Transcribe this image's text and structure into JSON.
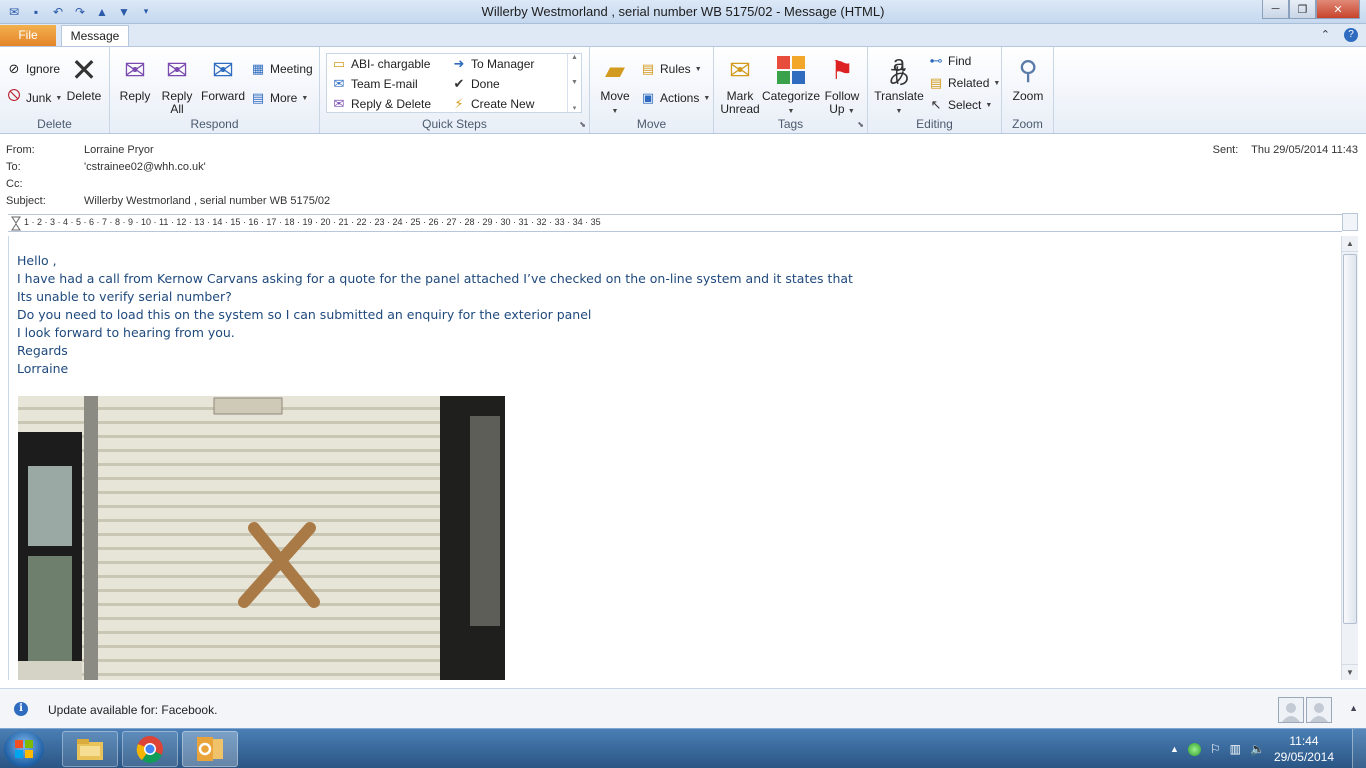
{
  "window": {
    "title": "Willerby Westmorland , serial number WB 5175/02  -  Message (HTML)",
    "minimize_icon": "minimize-icon",
    "maximize_icon": "restore-icon",
    "close_icon": "close-icon"
  },
  "tabs": {
    "file": "File",
    "message": "Message"
  },
  "ribbon": {
    "delete_group": {
      "label": "Delete",
      "ignore": "Ignore",
      "junk": "Junk",
      "delete": "Delete"
    },
    "respond_group": {
      "label": "Respond",
      "reply": "Reply",
      "reply_all_line1": "Reply",
      "reply_all_line2": "All",
      "forward": "Forward",
      "meeting": "Meeting",
      "more": "More"
    },
    "quick_steps_group": {
      "label": "Quick Steps",
      "items": [
        "ABI- chargable",
        "To Manager",
        "Team E-mail",
        "Done",
        "Reply & Delete",
        "Create New"
      ]
    },
    "move_group": {
      "label": "Move",
      "move": "Move",
      "rules": "Rules",
      "actions": "Actions"
    },
    "tags_group": {
      "label": "Tags",
      "mark_unread_line1": "Mark",
      "mark_unread_line2": "Unread",
      "categorize": "Categorize",
      "follow_up_line1": "Follow",
      "follow_up_line2": "Up"
    },
    "editing_group": {
      "label": "Editing",
      "translate": "Translate",
      "find": "Find",
      "related": "Related",
      "select": "Select"
    },
    "zoom_group": {
      "label": "Zoom",
      "zoom": "Zoom"
    }
  },
  "header": {
    "from_label": "From:",
    "from_value": "Lorraine Pryor",
    "to_label": "To:",
    "to_value": "'cstrainee02@whh.co.uk'",
    "cc_label": "Cc:",
    "cc_value": "",
    "subject_label": "Subject:",
    "subject_value": "Willerby Westmorland , serial number WB 5175/02",
    "sent_label": "Sent:",
    "sent_value": "Thu 29/05/2014 11:43"
  },
  "ruler": {
    "numbers": "1 · 2 · 3 · 4 · 5 · 6 · 7 · 8 · 9 · 10 · 11 · 12 · 13 · 14 · 15 · 16 · 17 · 18 · 19 · 20 · 21 · 22 · 23 · 24 · 25 · 26 · 27 · 28 · 29 · 30 · 31 · 32 · 33 · 34 · 35"
  },
  "body": {
    "lines": [
      "Hello ,",
      "I have had a call from Kernow Carvans asking for a quote for the panel attached I’ve checked on the on-line system and it states that",
      "Its unable to verify serial number?",
      "Do you need to load this on the system so I can submitted an enquiry for the exterior panel",
      "I look forward to hearing from you.",
      "Regards",
      "Lorraine"
    ],
    "text_color": "#1f497d"
  },
  "infobar": {
    "message": "Update available for: Facebook."
  },
  "taskbar": {
    "time": "11:44",
    "date": "29/05/2014",
    "apps": [
      "file-explorer-icon",
      "chrome-icon",
      "outlook-icon"
    ]
  }
}
